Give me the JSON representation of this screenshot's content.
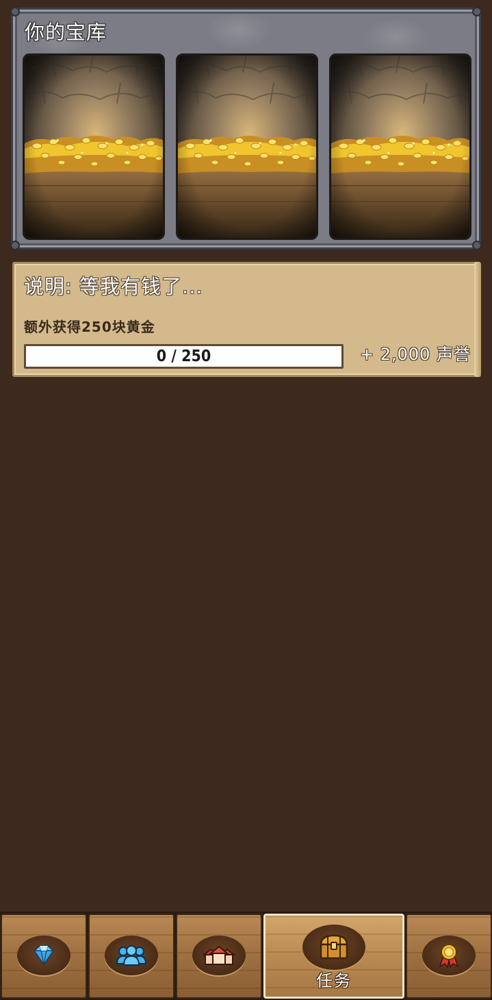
{
  "vault": {
    "title": "你的宝库",
    "slots": [
      {
        "item": "gold-pile"
      },
      {
        "item": "gold-pile"
      },
      {
        "item": "gold-pile"
      }
    ]
  },
  "quest": {
    "title": "说明: 等我有钱了...",
    "goal": "额外获得250块黄金",
    "progress_text": "0 / 250",
    "progress_fraction": 0,
    "reward": "+ 2,000 声誉"
  },
  "nav": {
    "tabs": [
      {
        "icon": "diamond-icon",
        "label": ""
      },
      {
        "icon": "people-icon",
        "label": ""
      },
      {
        "icon": "buildings-icon",
        "label": ""
      },
      {
        "icon": "treasure-chest-icon",
        "label": "任务",
        "active": true
      },
      {
        "icon": "medal-icon",
        "label": ""
      }
    ]
  },
  "colors": {
    "background": "#3d291e",
    "parchment": "#d3b98c",
    "stone": "#7b7c85",
    "gold": "#e8c24a"
  }
}
